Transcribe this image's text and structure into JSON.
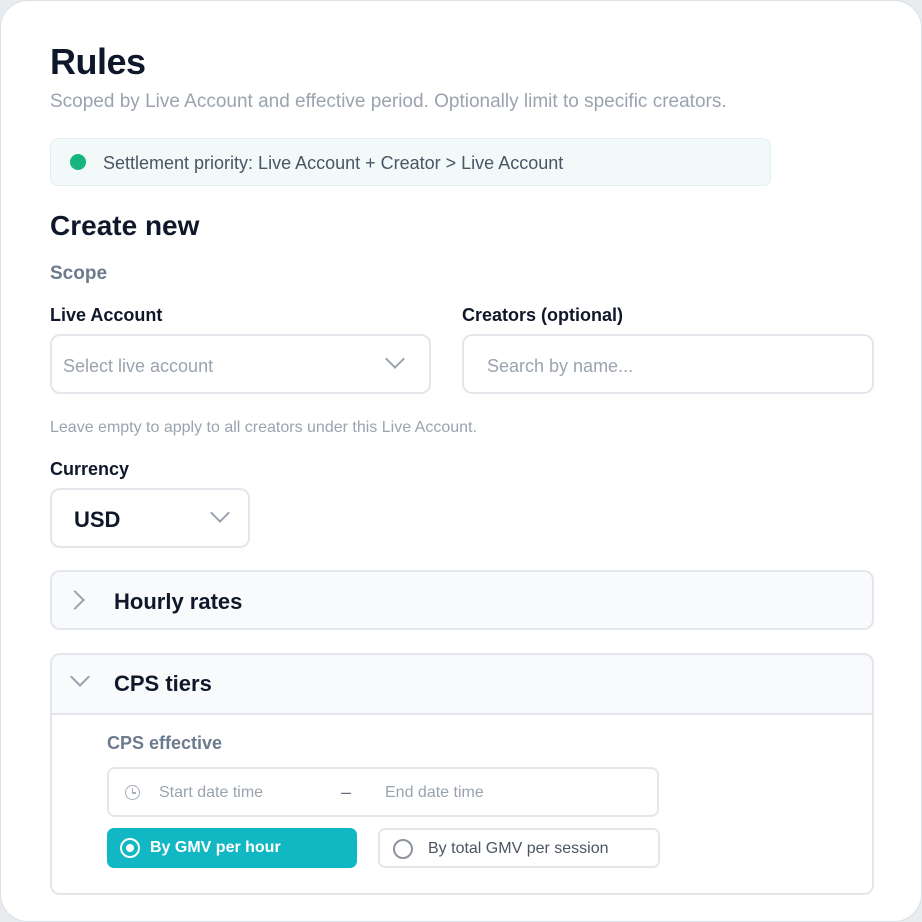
{
  "header": {
    "title": "Rules",
    "subtitle": "Scoped by Live Account and effective period. Optionally limit to specific creators."
  },
  "banner": {
    "text": "Settlement priority: Live Account + Creator > Live Account",
    "dot_color": "#16b47e"
  },
  "form": {
    "heading": "Create new",
    "scope_label": "Scope",
    "live_account": {
      "label": "Live Account",
      "placeholder": "Select live account"
    },
    "creators": {
      "label": "Creators (optional)",
      "placeholder": "Search by name..."
    },
    "hint": "Leave empty to apply to all creators under this Live Account.",
    "currency": {
      "label": "Currency",
      "value": "USD"
    }
  },
  "accordions": {
    "hourly": {
      "title": "Hourly rates",
      "expanded": false
    },
    "cps": {
      "title": "CPS tiers",
      "expanded": true,
      "effective_label": "CPS effective",
      "start_placeholder": "Start date time",
      "separator": "–",
      "end_placeholder": "End date time",
      "options": [
        {
          "label": "By GMV per hour",
          "selected": true
        },
        {
          "label": "By total GMV per session",
          "selected": false
        }
      ],
      "accent_color": "#12b7c4"
    }
  }
}
